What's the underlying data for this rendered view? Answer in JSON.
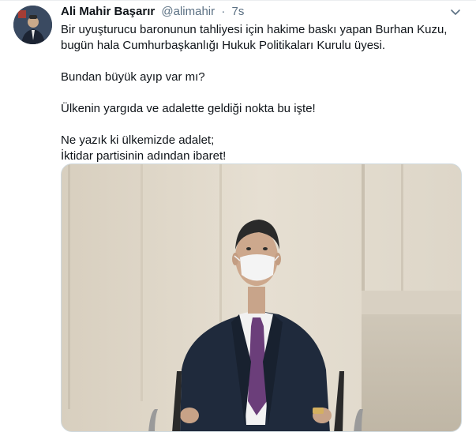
{
  "tweet": {
    "author_name": "Ali Mahir Başarır",
    "author_handle": "@alimahir",
    "separator": "·",
    "time": "7s",
    "text_lines": [
      "Bir uyuşturucu baronunun tahliyesi için hakime baskı yapan Burhan Kuzu,",
      "bugün hala Cumhurbaşkanlığı Hukuk Politikaları Kurulu üyesi.",
      "Bundan büyük ayıp var mı?",
      "Ülkenin yargıda ve adalette geldiği nokta bu işte!",
      "Ne yazık ki ülkemizde adalet;",
      "İktidar partisinin adından ibaret!"
    ]
  },
  "icons": {
    "avatar": "profile-photo",
    "caret": "chevron-down-icon",
    "media": "video-thumbnail"
  },
  "colors": {
    "text_primary": "#0f1419",
    "text_secondary": "#5b7083",
    "border": "#cfd9de"
  }
}
